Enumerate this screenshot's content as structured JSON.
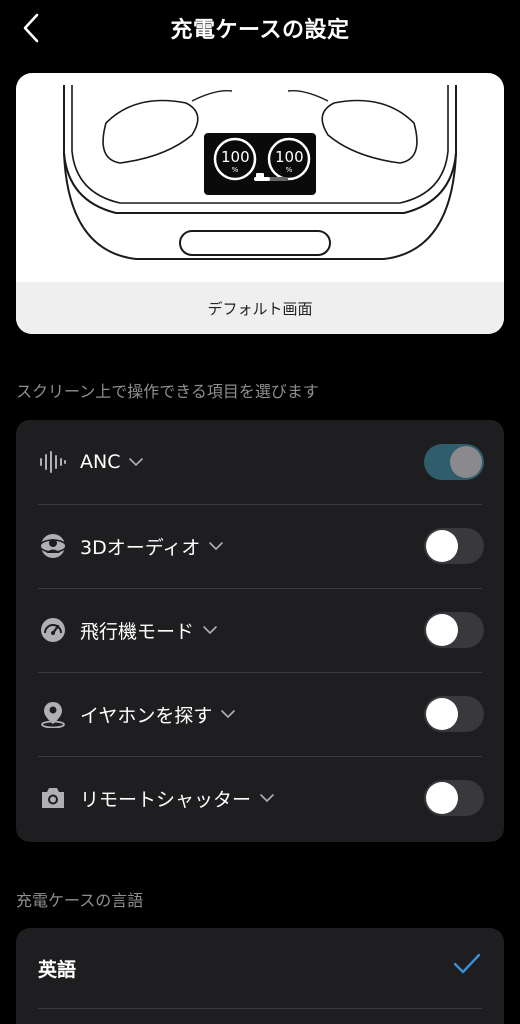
{
  "header": {
    "title": "充電ケースの設定",
    "back_icon": "chevron-left-icon"
  },
  "preview": {
    "caption": "デフォルト画面",
    "left_battery": "100",
    "right_battery": "100",
    "unit": "%"
  },
  "controls_section": {
    "label": "スクリーン上で操作できる項目を選びます",
    "items": [
      {
        "label": "ANC",
        "icon": "sound-wave-icon",
        "enabled": true
      },
      {
        "label": "3Dオーディオ",
        "icon": "3d-audio-icon",
        "enabled": false
      },
      {
        "label": "飛行機モード",
        "icon": "gauge-icon",
        "enabled": false
      },
      {
        "label": "イヤホンを探す",
        "icon": "location-pin-icon",
        "enabled": false
      },
      {
        "label": "リモートシャッター",
        "icon": "camera-icon",
        "enabled": false
      }
    ]
  },
  "language_section": {
    "label": "充電ケースの言語",
    "items": [
      {
        "label": "英語",
        "selected": true
      }
    ]
  },
  "colors": {
    "accent": "#3a8fd6",
    "toggle_on_track": "#2f5d6b",
    "toggle_off_track": "#39393d",
    "group_bg": "#1e1e20"
  }
}
